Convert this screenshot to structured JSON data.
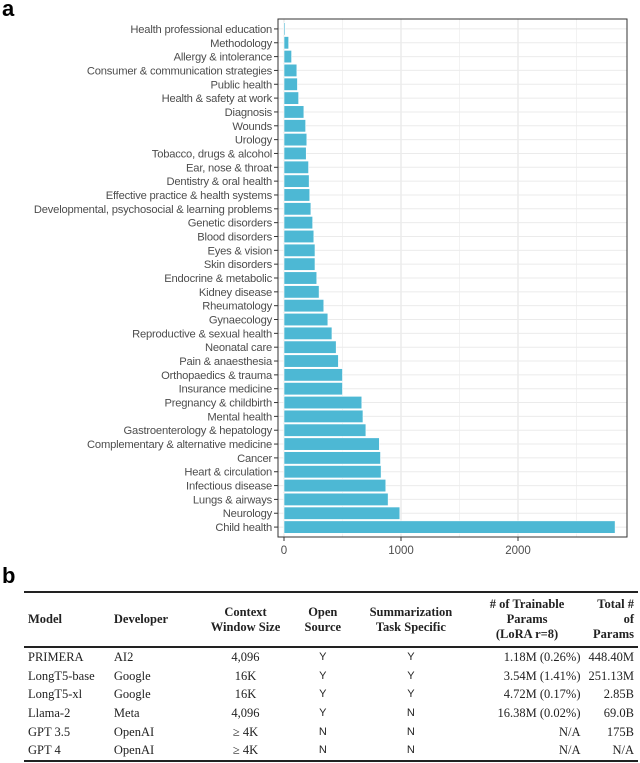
{
  "panels": {
    "a": "a",
    "b": "b"
  },
  "chart_data": {
    "type": "bar",
    "orientation": "horizontal",
    "title": "",
    "xlabel": "",
    "ylabel": "",
    "xlim": [
      0,
      2900
    ],
    "xticks": [
      0,
      1000,
      2000
    ],
    "grid": true,
    "bar_color": "#4db8d4",
    "categories": [
      "Health professional education",
      "Methodology",
      "Allergy & intolerance",
      "Consumer & communication strategies",
      "Public health",
      "Health & safety at work",
      "Diagnosis",
      "Wounds",
      "Urology",
      "Tobacco, drugs & alcohol",
      "Ear, nose & throat",
      "Dentistry & oral health",
      "Effective practice & health systems",
      "Developmental, psychosocial & learning problems",
      "Genetic disorders",
      "Blood disorders",
      "Eyes & vision",
      "Skin disorders",
      "Endocrine & metabolic",
      "Kidney disease",
      "Rheumatology",
      "Gynaecology",
      "Reproductive & sexual health",
      "Neonatal care",
      "Pain & anaesthesia",
      "Orthopaedics & trauma",
      "Insurance medicine",
      "Pregnancy & childbirth",
      "Mental health",
      "Gastroenterology & hepatology",
      "Complementary & alternative medicine",
      "Cancer",
      "Heart & circulation",
      "Infectious disease",
      "Lungs & airways",
      "Neurology",
      "Child health"
    ],
    "values": [
      10,
      40,
      65,
      110,
      115,
      125,
      170,
      185,
      195,
      190,
      210,
      215,
      220,
      230,
      245,
      255,
      265,
      265,
      280,
      300,
      340,
      375,
      410,
      446,
      465,
      500,
      500,
      665,
      675,
      700,
      815,
      825,
      830,
      870,
      890,
      990,
      2830
    ]
  },
  "table": {
    "headers": [
      [
        "Model"
      ],
      [
        "Developer"
      ],
      [
        "Context",
        "Window Size"
      ],
      [
        "Open",
        "Source"
      ],
      [
        "Summarization",
        "Task Specific"
      ],
      [
        "# of Trainable",
        "Params",
        "(LoRA r=8)"
      ],
      [
        "Total # of",
        "Params"
      ]
    ],
    "rows": [
      [
        "PRIMERA",
        "AI2",
        "4,096",
        "Y",
        "Y",
        "1.18M (0.26%)",
        "448.40M"
      ],
      [
        "LongT5-base",
        "Google",
        "16K",
        "Y",
        "Y",
        "3.54M (1.41%)",
        "251.13M"
      ],
      [
        "LongT5-xl",
        "Google",
        "16K",
        "Y",
        "Y",
        "4.72M (0.17%)",
        "2.85B"
      ],
      [
        "Llama-2",
        "Meta",
        "4,096",
        "Y",
        "N",
        "16.38M (0.02%)",
        "69.0B"
      ],
      [
        "GPT 3.5",
        "OpenAI",
        "≥ 4K",
        "N",
        "N",
        "N/A",
        "175B"
      ],
      [
        "GPT 4",
        "OpenAI",
        "≥ 4K",
        "N",
        "N",
        "N/A",
        "N/A"
      ]
    ]
  }
}
